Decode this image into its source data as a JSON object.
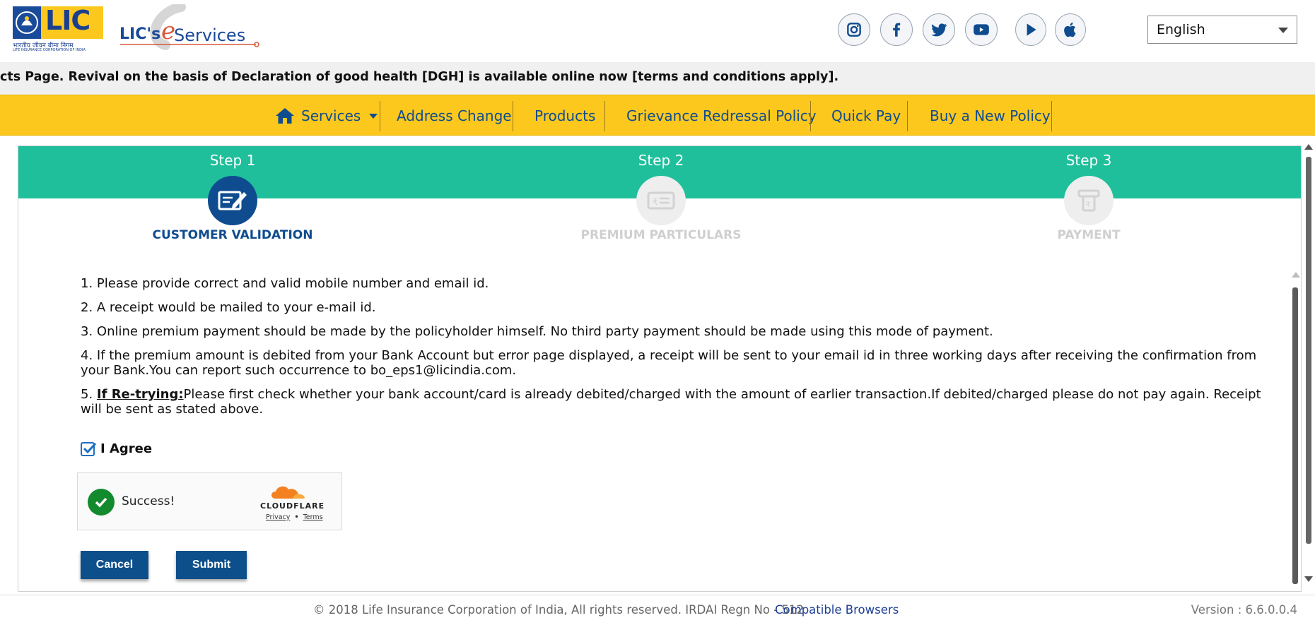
{
  "header": {
    "lic_logo_text": "LIC",
    "lic_logo_hindi": "भारतीय जीवन बीमा निगम",
    "lic_logo_sub": "LIFE INSURANCE CORPORATION OF INDIA",
    "eservices_prefix": "LIC's",
    "eservices_e": "e",
    "eservices_suffix": "Services",
    "social_icons": [
      "instagram-icon",
      "facebook-icon",
      "twitter-icon",
      "youtube-icon",
      "play-store-icon",
      "apple-icon"
    ],
    "language": "English"
  },
  "marquee": "cts Page.  Revival on the basis of Declaration of good health [DGH] is available online now [terms and conditions apply].",
  "nav": {
    "items": [
      {
        "label": "Services",
        "icon": "home-icon",
        "dropdown": true
      },
      {
        "label": "Address Change"
      },
      {
        "label": "Products"
      },
      {
        "label": "Grievance Redressal Policy"
      },
      {
        "label": "Quick Pay"
      },
      {
        "label": "Buy a New Policy"
      }
    ]
  },
  "steps": [
    {
      "title": "Step 1",
      "label": "CUSTOMER VALIDATION",
      "active": true,
      "icon": "edit-form-icon"
    },
    {
      "title": "Step 2",
      "label": "PREMIUM PARTICULARS",
      "active": false,
      "icon": "rupee-card-icon"
    },
    {
      "title": "Step 3",
      "label": "PAYMENT",
      "active": false,
      "icon": "atm-icon"
    }
  ],
  "instructions": {
    "item1": "1. Please provide correct and valid mobile number and email id.",
    "item2": "2. A receipt would be mailed to your e-mail id.",
    "item3": "3. Online premium payment should be made by the policyholder himself. No third party payment should be made using this mode of payment.",
    "item4": "4. If the premium amount is debited from your Bank Account but error page displayed, a receipt will be sent to your email id in three working days after receiving the confirmation from your Bank.You can report such occurrence to bo_eps1@licindia.com.",
    "item5_prefix": "5. ",
    "item5_emph": "If Re-trying:",
    "item5_text": "Please first check whether your bank account/card is already debited/charged with the amount of earlier transaction.If debited/charged please do not pay again. Receipt will be sent as stated above."
  },
  "agree": {
    "label": "I Agree",
    "checked": true
  },
  "captcha": {
    "status": "Success!",
    "brand": "CLOUDFLARE",
    "privacy": "Privacy",
    "sep": "•",
    "terms": "Terms"
  },
  "buttons": {
    "cancel": "Cancel",
    "submit": "Submit"
  },
  "footer": {
    "copyright": "© 2018 Life Insurance Corporation of India, All rights reserved. IRDAI Regn No - 512",
    "compatible": "Compatible Browsers",
    "version": "Version : 6.6.0.0.4"
  },
  "colors": {
    "brand_blue": "#0f4c8f",
    "nav_yellow": "#fcc81e",
    "step_teal": "#1fbf9b",
    "button_blue": "#0d4f8b"
  }
}
